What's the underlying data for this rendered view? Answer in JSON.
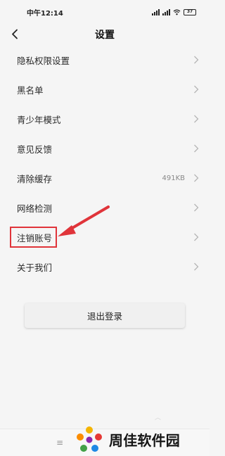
{
  "status_bar": {
    "time": "中午12:14",
    "battery": "37",
    "icons": [
      "signal-icon",
      "signal-icon",
      "wifi-icon",
      "battery-icon"
    ]
  },
  "header": {
    "title": "设置",
    "back_icon": "chevron-left-icon"
  },
  "settings": {
    "items": [
      {
        "label": "隐私权限设置",
        "value": ""
      },
      {
        "label": "黑名单",
        "value": ""
      },
      {
        "label": "青少年模式",
        "value": ""
      },
      {
        "label": "意见反馈",
        "value": ""
      },
      {
        "label": "清除缓存",
        "value": "491KB"
      },
      {
        "label": "网络检测",
        "value": ""
      },
      {
        "label": "注销账号",
        "value": ""
      },
      {
        "label": "关于我们",
        "value": ""
      }
    ]
  },
  "logout_label": "退出登录",
  "annotation": {
    "highlight_color": "#e0343a",
    "highlighted_item": "注销账号"
  },
  "watermark": {
    "text": "周佳软件园"
  },
  "colors": {
    "background": "#f5f5f5",
    "text": "#2a2a2a",
    "accent_annotation": "#e0343a"
  }
}
